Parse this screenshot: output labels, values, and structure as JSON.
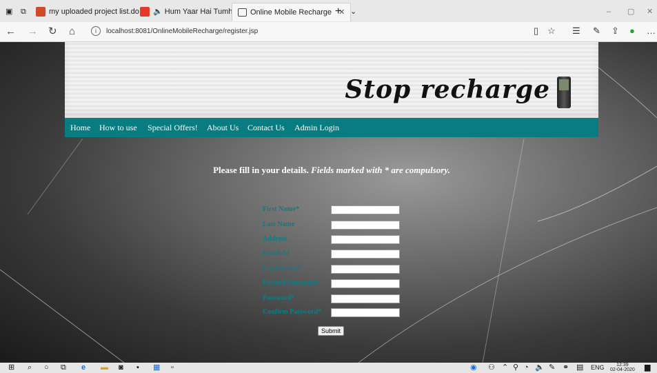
{
  "browser": {
    "tabs": [
      {
        "label": "my uploaded project list.do",
        "icon": "word-doc-icon"
      },
      {
        "label": "Hum Yaar Hai Tumhare",
        "icon": "youtube-icon"
      },
      {
        "label": "Online Mobile Recharge",
        "icon": "page-icon",
        "active": true
      }
    ],
    "address": "localhost:8081/OnlineMobileRecharge/register.jsp"
  },
  "site": {
    "logo": "Stop recharge",
    "menu": [
      "Home",
      "How to use",
      "Special Offers!",
      "About Us",
      "Contact Us",
      "Admin Login"
    ],
    "instructions": {
      "bold": "Please fill in your details.",
      "italic": "Fields marked with * are compulsory."
    },
    "form": {
      "fields": [
        {
          "label": "First Name*",
          "value": ""
        },
        {
          "label": "Last Name",
          "value": ""
        },
        {
          "label": "Address",
          "value": ""
        },
        {
          "label": "Email-Id",
          "value": ""
        },
        {
          "label": "Contact No.*",
          "value": ""
        },
        {
          "label": "Desired Username*",
          "value": ""
        },
        {
          "label": "Password*",
          "value": ""
        },
        {
          "label": "Confirm Password*",
          "value": ""
        }
      ],
      "submit": "Submit"
    }
  },
  "taskbar": {
    "language": "ENG",
    "time": "12:39",
    "date": "02-04-2020"
  }
}
